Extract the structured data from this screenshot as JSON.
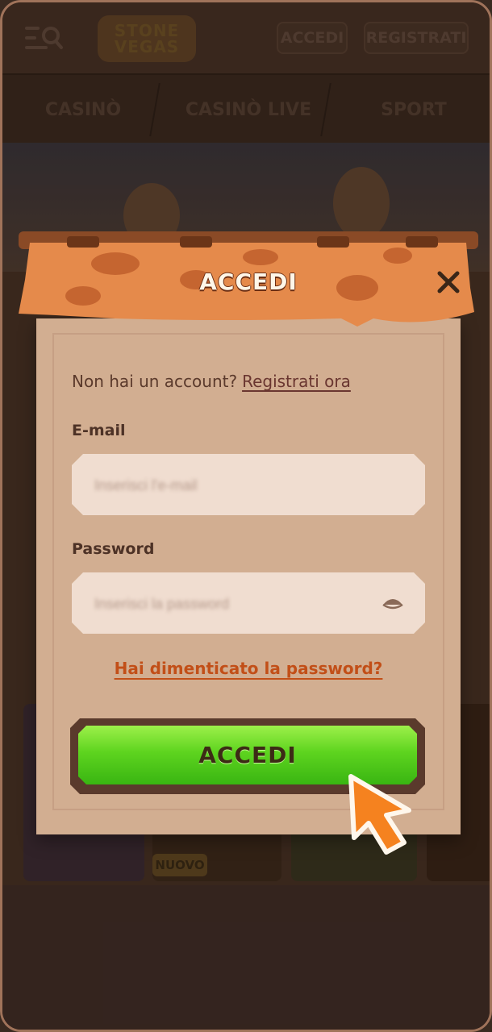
{
  "header": {
    "logo_line1": "STONE",
    "logo_line2": "VEGAS",
    "login_label": "ACCEDI",
    "register_label": "REGISTRATI"
  },
  "nav": {
    "items": [
      "CASINÒ",
      "CASINÒ LIVE",
      "SPORT"
    ]
  },
  "games": {
    "badge": "NUOVO"
  },
  "modal": {
    "title": "ACCEDI",
    "no_account_text": "Non hai un account?",
    "register_link": "Registrati ora",
    "email_label": "E-mail",
    "email_placeholder": "Inserisci l'e-mail",
    "password_label": "Password",
    "password_placeholder": "Inserisci la password",
    "forgot_link": "Hai dimenticato la password?",
    "submit_label": "ACCEDI"
  },
  "colors": {
    "accent_orange": "#c24f18",
    "button_green": "#5ed41f",
    "parchment": "#d2ae91"
  }
}
